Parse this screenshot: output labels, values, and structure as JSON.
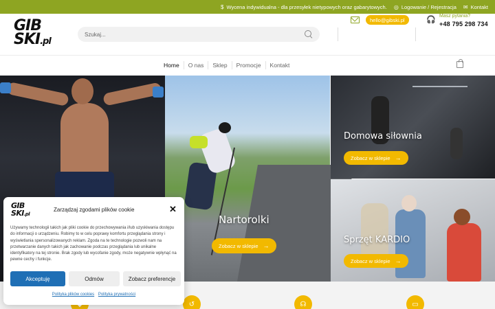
{
  "topbar": {
    "valuation": "Wycena indywidualna - dla przesyłek nietypowych oraz gabarytowych.",
    "login": "Logowanie / Rejestracja",
    "contact": "Kontakt"
  },
  "header": {
    "logo_line1": "GIB",
    "logo_line2": "SKI",
    "logo_suffix": ".pl",
    "search_placeholder": "Szukaj...",
    "email": "hello@gibski.pl",
    "phone_question": "Masz pytania?",
    "phone_number": "+48 795 298 734"
  },
  "nav": {
    "items": [
      "Home",
      "O nas",
      "Sklep",
      "Promocje",
      "Kontakt"
    ]
  },
  "tiles": {
    "nartorolki": {
      "title": "Nartorolki",
      "button": "Zobacz w sklepie"
    },
    "domowa": {
      "title": "Domowa siłownia",
      "button": "Zobacz w sklepie"
    },
    "kardio": {
      "title": "Sprzęt KARDIO",
      "button": "Zobacz w sklepie"
    }
  },
  "cookie": {
    "title": "Zarządzaj zgodami plików cookie",
    "text": "Używamy technologii takich jak pliki cookie do przechowywania i/lub uzyskiwania dostępu do informacji o urządzeniu. Robimy to w celu poprawy komfortu przeglądania strony i wyświetlania spersonalizowanych reklam. Zgoda na te technologie pozwoli nam na przetwarzanie danych takich jak zachowanie podczas przeglądania lub unikalne identyfikatory na tej stronie. Brak zgody lub wycofanie zgody, może negatywnie wpłynąć na pewne cechy i funkcje.",
    "accept": "Akceptuję",
    "deny": "Odmów",
    "preferences": "Zobacz preferencje",
    "link_cookies": "Polityka plików cookies",
    "link_privacy": "Polityka prywatności"
  },
  "colors": {
    "brand_green": "#8ea522",
    "accent_yellow": "#f2b900",
    "accept_blue": "#1f6fb5"
  }
}
